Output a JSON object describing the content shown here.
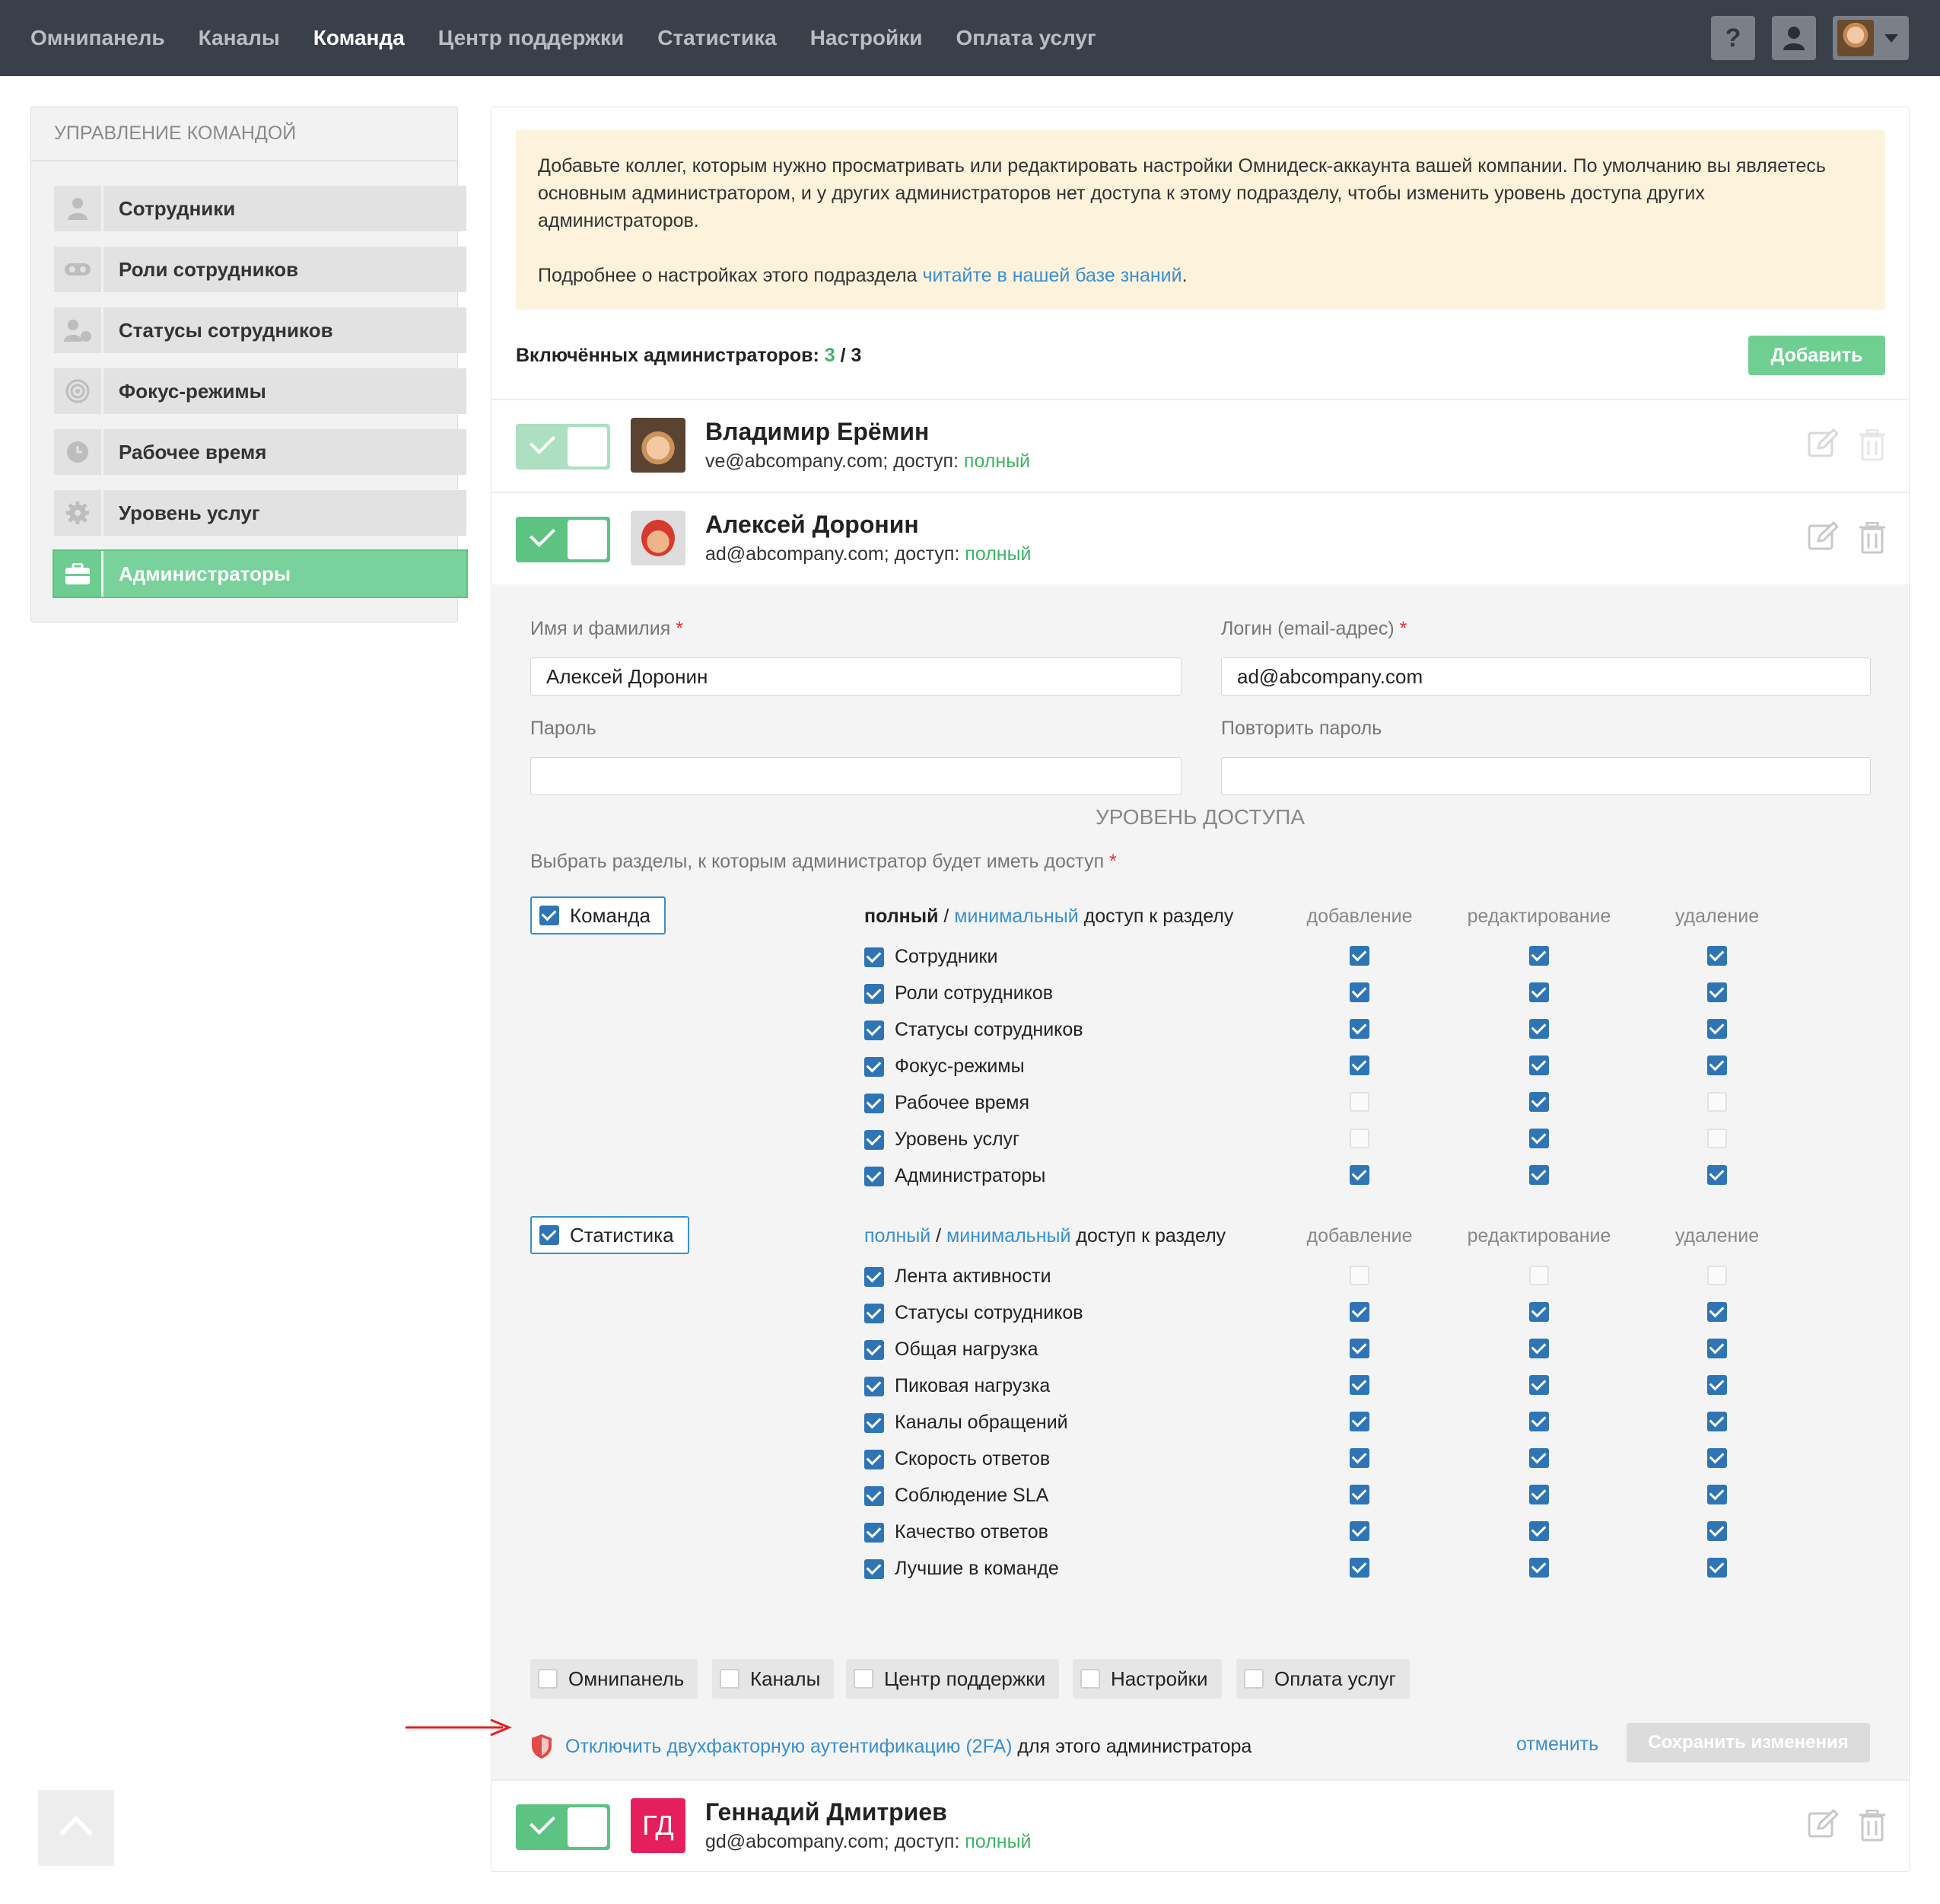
{
  "nav": {
    "items": [
      "Омнипанель",
      "Каналы",
      "Команда",
      "Центр поддержки",
      "Статистика",
      "Настройки",
      "Оплата услуг"
    ],
    "active_index": 2,
    "help_label": "?"
  },
  "sidebar": {
    "title": "Управление командой",
    "items": [
      {
        "label": "Сотрудники",
        "icon": "user-icon"
      },
      {
        "label": "Роли сотрудников",
        "icon": "mask-icon"
      },
      {
        "label": "Статусы сотрудников",
        "icon": "user-status-icon"
      },
      {
        "label": "Фокус-режимы",
        "icon": "target-icon"
      },
      {
        "label": "Рабочее время",
        "icon": "clock-icon"
      },
      {
        "label": "Уровень услуг",
        "icon": "gear-icon"
      },
      {
        "label": "Администраторы",
        "icon": "briefcase-icon",
        "active": true
      }
    ]
  },
  "info": {
    "text1": "Добавьте коллег, которым нужно просматривать или редактировать настройки Омнидеск-аккаунта вашей компании. По умолчанию вы являетесь основным администратором, и у других администраторов нет доступа к этому подразделу, чтобы изменить уровень доступа других администраторов.",
    "text2_prefix": "Подробнее о настройках этого подраздела ",
    "text2_link": "читайте в нашей базе знаний",
    "text2_suffix": "."
  },
  "admins_counter": {
    "label": "Включённых администраторов: ",
    "enabled": "3",
    "separator": " / ",
    "total": "3"
  },
  "add_button": "Добавить",
  "admins": [
    {
      "name": "Владимир Ерёмин",
      "email": "ve@abcompany.com; доступ: ",
      "access": "полный",
      "enabled": true
    },
    {
      "name": "Алексей Доронин",
      "email": "ad@abcompany.com; доступ: ",
      "access": "полный",
      "enabled": true
    },
    {
      "name": "Геннадий Дмитриев",
      "initials": "ГД",
      "email": "gd@abcompany.com; доступ: ",
      "access": "полный",
      "enabled": true
    }
  ],
  "form": {
    "name_label": "Имя и фамилия",
    "name_value": "Алексей Доронин",
    "login_label": "Логин (email-адрес)",
    "login_value": "ad@abcompany.com",
    "password_label": "Пароль",
    "repeat_password_label": "Повторить пароль",
    "required_mark": "*",
    "access_title": "Уровень доступа",
    "access_hint": "Выбрать разделы, к которым администратор будет иметь доступ",
    "columns": [
      "добавление",
      "редактирование",
      "удаление"
    ],
    "full_label": "полный",
    "slash": " / ",
    "minimal_label": "минимальный",
    "section_access_suffix": " доступ к разделу",
    "groups": [
      {
        "label": "Команда",
        "checked": true,
        "full_selected": true,
        "rows": [
          {
            "label": "Сотрудники",
            "checked": true,
            "add": "on",
            "edit": "on",
            "delete": "on"
          },
          {
            "label": "Роли сотрудников",
            "checked": true,
            "add": "on",
            "edit": "on",
            "delete": "on"
          },
          {
            "label": "Статусы сотрудников",
            "checked": true,
            "add": "on",
            "edit": "on",
            "delete": "on"
          },
          {
            "label": "Фокус-режимы",
            "checked": true,
            "add": "on",
            "edit": "on",
            "delete": "on"
          },
          {
            "label": "Рабочее время",
            "checked": true,
            "add": "dis",
            "edit": "on",
            "delete": "dis"
          },
          {
            "label": "Уровень услуг",
            "checked": true,
            "add": "dis",
            "edit": "on",
            "delete": "dis"
          },
          {
            "label": "Администраторы",
            "checked": true,
            "add": "on",
            "edit": "on",
            "delete": "on"
          }
        ]
      },
      {
        "label": "Статистика",
        "checked": true,
        "full_selected": false,
        "rows": [
          {
            "label": "Лента активности",
            "checked": true,
            "add": "dis",
            "edit": "dis",
            "delete": "dis"
          },
          {
            "label": "Статусы сотрудников",
            "checked": true,
            "add": "on",
            "edit": "on",
            "delete": "on"
          },
          {
            "label": "Общая нагрузка",
            "checked": true,
            "add": "on",
            "edit": "on",
            "delete": "on"
          },
          {
            "label": "Пиковая нагрузка",
            "checked": true,
            "add": "on",
            "edit": "on",
            "delete": "on"
          },
          {
            "label": "Каналы обращений",
            "checked": true,
            "add": "on",
            "edit": "on",
            "delete": "on"
          },
          {
            "label": "Скорость ответов",
            "checked": true,
            "add": "on",
            "edit": "on",
            "delete": "on"
          },
          {
            "label": "Соблюдение SLA",
            "checked": true,
            "add": "on",
            "edit": "on",
            "delete": "on"
          },
          {
            "label": "Качество ответов",
            "checked": true,
            "add": "on",
            "edit": "on",
            "delete": "on"
          },
          {
            "label": "Лучшие в команде",
            "checked": true,
            "add": "on",
            "edit": "on",
            "delete": "on"
          }
        ]
      }
    ],
    "other_sections": [
      "Омнипанель",
      "Каналы",
      "Центр поддержки",
      "Настройки",
      "Оплата услуг"
    ],
    "twofa_link": "Отключить двухфакторную аутентификацию (2FA)",
    "twofa_suffix": " для этого администратора",
    "cancel_label": "отменить",
    "save_label": "Сохранить изменения"
  },
  "colors": {
    "nav_bg": "#3a4049",
    "accent_green": "#5cc383",
    "link_blue": "#3a8fd0",
    "info_bg": "#fdf3dc",
    "checkbox_blue": "#2f75b5",
    "annotation_red": "#e3201f"
  }
}
